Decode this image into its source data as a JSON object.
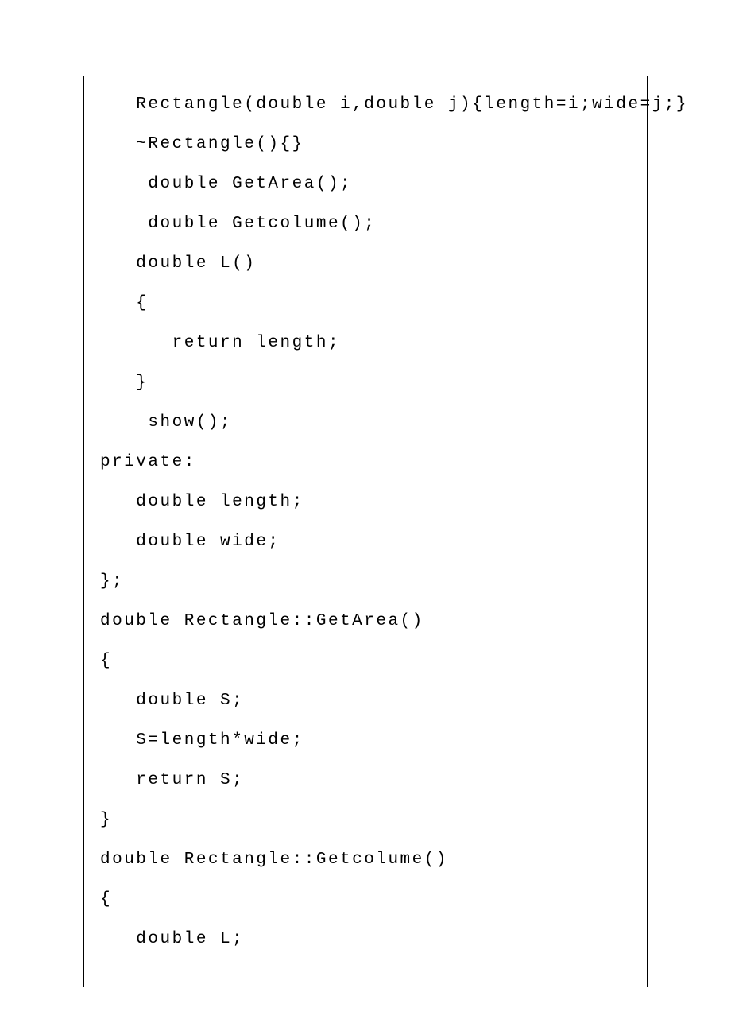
{
  "code": {
    "lines": [
      "   Rectangle(double i,double j){length=i;wide=j;}",
      "   ~Rectangle(){}",
      "    double GetArea();",
      "    double Getcolume();",
      "   double L()",
      "   {",
      "      return length;",
      "   }",
      "    show();",
      "private:",
      "   double length;",
      "   double wide;",
      "};",
      "double Rectangle::GetArea()",
      "{",
      "   double S;",
      "   S=length*wide;",
      "   return S;",
      "}",
      "double Rectangle::Getcolume()",
      "{",
      "   double L;"
    ]
  }
}
